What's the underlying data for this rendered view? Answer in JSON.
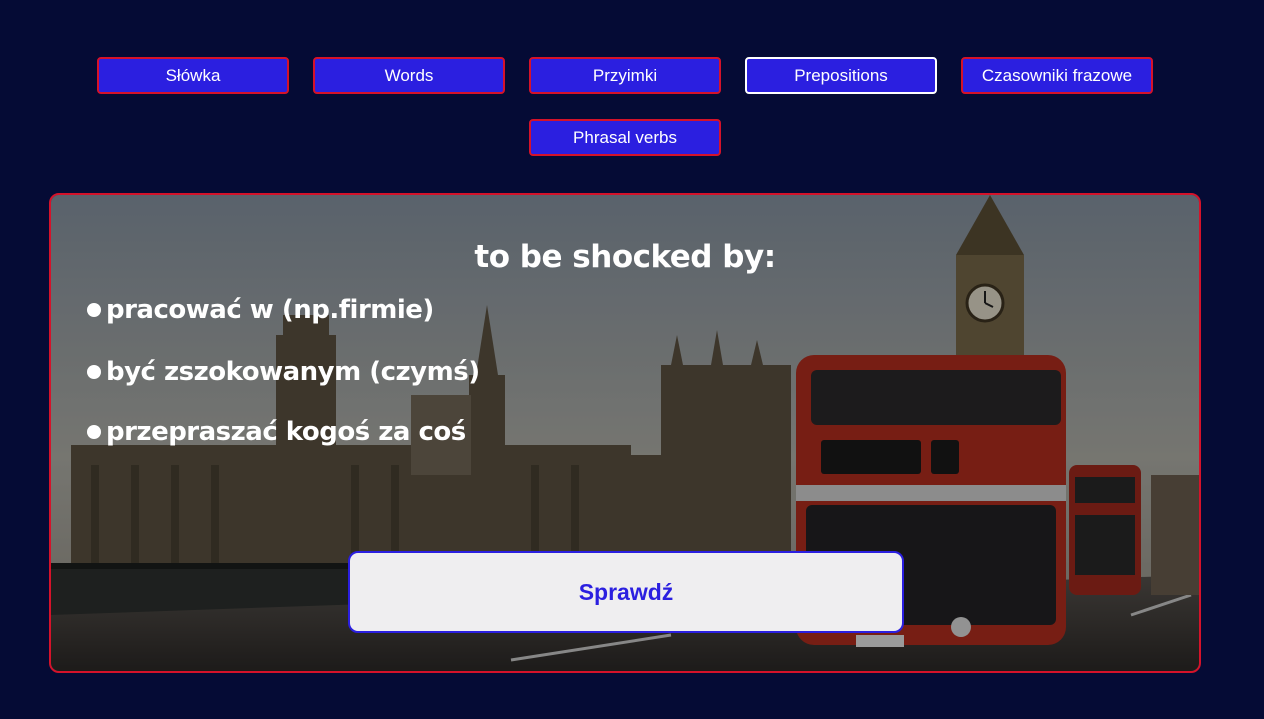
{
  "nav": {
    "items": [
      {
        "label": "Słówka"
      },
      {
        "label": "Words"
      },
      {
        "label": "Przyimki"
      },
      {
        "label": "Prepositions",
        "active": true
      },
      {
        "label": "Czasowniki frazowe"
      },
      {
        "label": "Phrasal verbs"
      }
    ]
  },
  "quiz": {
    "question": "to be shocked by:",
    "options": [
      "pracować w (np.firmie)",
      "być zszokowanym (czymś)",
      "przepraszać kogoś za coś"
    ],
    "check_label": "Sprawdź",
    "background_image": "london-westminster-bus-photo"
  },
  "colors": {
    "page_bg": "#050b35",
    "button_bg": "#2b1fe0",
    "button_border": "#d5122a",
    "active_border": "#ffffff",
    "check_text": "#2b1fe0"
  }
}
